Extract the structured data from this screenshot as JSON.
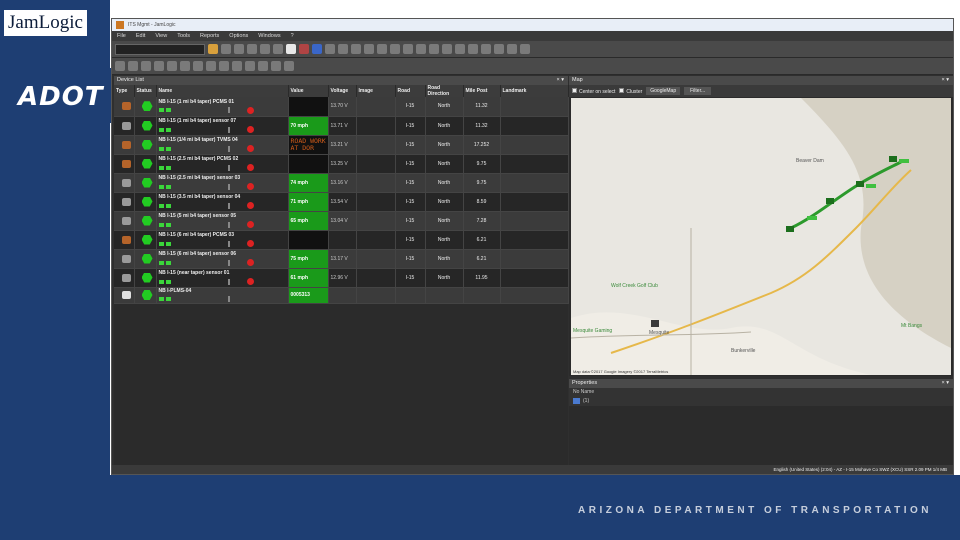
{
  "slide": {
    "brand": "JamLogic",
    "logo": "ADOT",
    "footer": "ARIZONA DEPARTMENT OF TRANSPORTATION"
  },
  "app": {
    "title": "ITS Mgmt - JamLogic",
    "menu": [
      "File",
      "Edit",
      "View",
      "Tools",
      "Reports",
      "Options",
      "Windows",
      "?"
    ],
    "device_panel_title": "Device List",
    "map_panel_title": "Map",
    "properties_panel_title": "Properties",
    "columns": [
      "Type",
      "Status",
      "Name",
      "Value",
      "Voltage",
      "Image",
      "Road",
      "Road Direction",
      "Mile Post",
      "Landmark"
    ],
    "devices": [
      {
        "type": "sign",
        "name": "NB I-15 (1 mi b4 taper) PCMS 01",
        "value": "",
        "value_style": "blackval",
        "voltage": "13.70 V",
        "road": "I-15",
        "direction": "North",
        "milepost": "11.32"
      },
      {
        "type": "sensor",
        "name": "NB I-15 (1 mi b4 taper) sensor 07",
        "value": "70 mph",
        "value_style": "green",
        "voltage": "13.71 V",
        "road": "I-15",
        "direction": "North",
        "milepost": "11.32"
      },
      {
        "type": "sign",
        "name": "NB I-15 (1/4 mi b4 taper) TVMS 04",
        "value": "ROAD WORK AT DOR",
        "value_style": "blackmsg",
        "voltage": "13.21 V",
        "road": "I-15",
        "direction": "North",
        "milepost": "17.252"
      },
      {
        "type": "sign",
        "name": "NB I-15 (2.5 mi b4 taper) PCMS 02",
        "value": "",
        "value_style": "blackval",
        "voltage": "13.25 V",
        "road": "I-15",
        "direction": "North",
        "milepost": "9.75"
      },
      {
        "type": "sensor",
        "name": "NB I-15 (2.5 mi b4 taper) sensor 03",
        "value": "74 mph",
        "value_style": "green",
        "voltage": "13.16 V",
        "road": "I-15",
        "direction": "North",
        "milepost": "9.75"
      },
      {
        "type": "sensor",
        "name": "NB I-15 (3.5 mi b4 taper) sensor 04",
        "value": "71 mph",
        "value_style": "green",
        "voltage": "13.54 V",
        "road": "I-15",
        "direction": "North",
        "milepost": "8.59"
      },
      {
        "type": "sensor",
        "name": "NB I-15 (5 mi b4 taper) sensor 05",
        "value": "65 mph",
        "value_style": "green",
        "voltage": "13.04 V",
        "road": "I-15",
        "direction": "North",
        "milepost": "7.28"
      },
      {
        "type": "sign",
        "name": "NB I-15 (6 mi b4 taper) PCMS 03",
        "value": "",
        "value_style": "blackval",
        "voltage": "",
        "road": "I-15",
        "direction": "North",
        "milepost": "6.21"
      },
      {
        "type": "sensor",
        "name": "NB I-15 (6 mi b4 taper) sensor 06",
        "value": "75 mph",
        "value_style": "green",
        "voltage": "13.17 V",
        "road": "I-15",
        "direction": "North",
        "milepost": "6.21"
      },
      {
        "type": "sensor",
        "name": "NB I-15 (near taper) sensor 01",
        "value": "61 mph",
        "value_style": "green",
        "voltage": "12.96 V",
        "road": "I-15",
        "direction": "North",
        "milepost": "11.95"
      },
      {
        "type": "mobile",
        "name": "NB I-PLMS-04",
        "value": "0005313",
        "value_style": "green",
        "voltage": "",
        "road": "",
        "direction": "",
        "milepost": ""
      }
    ],
    "map": {
      "center_checkbox": "Center on select",
      "cluster_checkbox": "Cluster",
      "map_type": "GoogleMap",
      "filter_button": "Filter...",
      "labels": [
        "Beaver Dam",
        "Wolf Creek Golf Club",
        "Mesquite Gaming",
        "Mesquite",
        "Bunkerville",
        "Mt Bangs"
      ],
      "attribution": "Map data ©2017 Google Imagery ©2017 TerraMetrics"
    },
    "properties": {
      "row1": "No Name",
      "row2": "(1)"
    },
    "status_bar": "English (United States) (2:04) - AZ - I-15 Mohave Co SWZ (XCU) SSR 2.09 PM 1/4 MB"
  }
}
